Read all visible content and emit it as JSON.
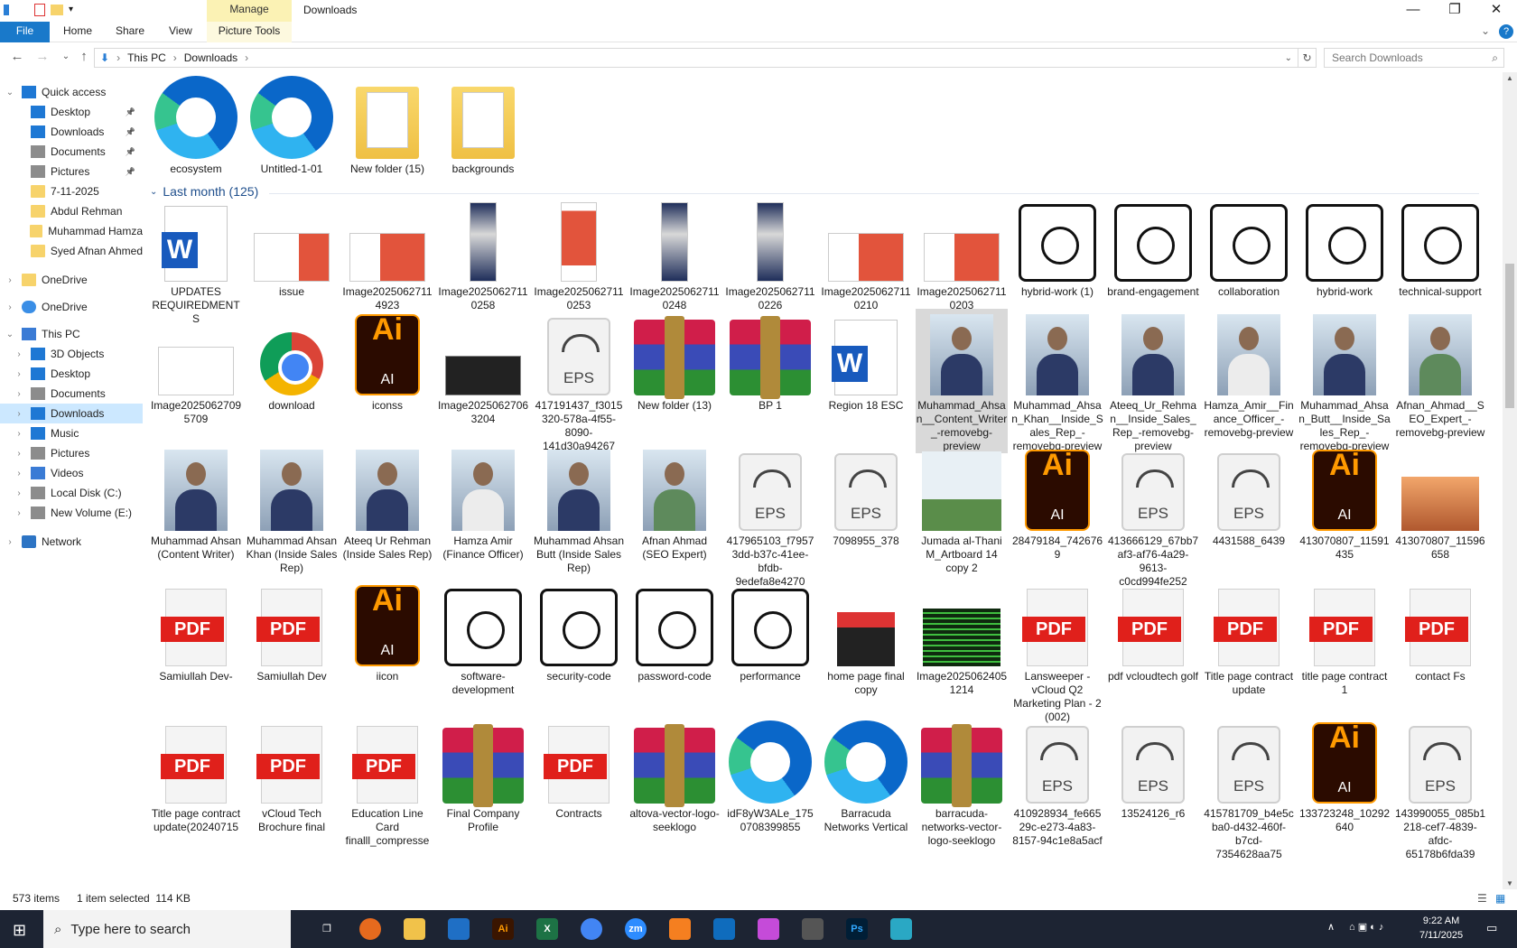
{
  "window": {
    "title": "Downloads",
    "manage_tab": "Manage",
    "controls": {
      "minimize": "—",
      "maximize": "❐",
      "close": "✕"
    }
  },
  "ribbon": {
    "tabs": [
      "File",
      "Home",
      "Share",
      "View"
    ],
    "picture_tools": "Picture Tools"
  },
  "address": {
    "path": [
      "This PC",
      "Downloads"
    ],
    "search_placeholder": "Search Downloads"
  },
  "nav": {
    "items": [
      {
        "label": "Quick access",
        "icon": "star-icon"
      },
      {
        "label": "Desktop",
        "icon": "desktop-icon",
        "pinned": true
      },
      {
        "label": "Downloads",
        "icon": "downloads-icon",
        "pinned": true
      },
      {
        "label": "Documents",
        "icon": "documents-icon",
        "pinned": true
      },
      {
        "label": "Pictures",
        "icon": "pictures-icon",
        "pinned": true
      },
      {
        "label": "7-11-2025",
        "icon": "folder-icon"
      },
      {
        "label": "Abdul Rehman",
        "icon": "folder-icon"
      },
      {
        "label": "Muhammad Hamza",
        "icon": "folder-icon"
      },
      {
        "label": "Syed Afnan Ahmed",
        "icon": "folder-icon"
      },
      {
        "label": "OneDrive",
        "icon": "folder-icon"
      },
      {
        "label": "OneDrive",
        "icon": "cloud-icon"
      },
      {
        "label": "This PC",
        "icon": "pc-icon"
      },
      {
        "label": "3D Objects",
        "icon": "3d-objects-icon"
      },
      {
        "label": "Desktop",
        "icon": "desktop-icon"
      },
      {
        "label": "Documents",
        "icon": "documents-icon"
      },
      {
        "label": "Downloads",
        "icon": "downloads-icon",
        "selected": true
      },
      {
        "label": "Music",
        "icon": "music-icon"
      },
      {
        "label": "Pictures",
        "icon": "pictures-icon"
      },
      {
        "label": "Videos",
        "icon": "videos-icon"
      },
      {
        "label": "Local Disk (C:)",
        "icon": "drive-icon"
      },
      {
        "label": "New Volume (E:)",
        "icon": "drive-icon"
      },
      {
        "label": "Network",
        "icon": "network-icon"
      }
    ]
  },
  "content": {
    "top_items": [
      {
        "label": "ecosystem",
        "kind": "edge"
      },
      {
        "label": "Untitled-1-01",
        "kind": "edge"
      },
      {
        "label": "New folder (15)",
        "kind": "folder"
      },
      {
        "label": "backgrounds",
        "kind": "folder"
      }
    ],
    "group_title": "Last month (125)",
    "rows": [
      [
        {
          "label": "UPDATES REQUIREDMENTS",
          "kind": "word"
        },
        {
          "label": "issue",
          "kind": "screen"
        },
        {
          "label": "Image20250627114923",
          "kind": "docred"
        },
        {
          "label": "Image20250627110258",
          "kind": "tall"
        },
        {
          "label": "Image20250627110253",
          "kind": "tallred"
        },
        {
          "label": "Image20250627110248",
          "kind": "tall"
        },
        {
          "label": "Image20250627110226",
          "kind": "tall"
        },
        {
          "label": "Image20250627110210",
          "kind": "docred"
        },
        {
          "label": "Image20250627110203",
          "kind": "docred"
        },
        {
          "label": "hybrid-work (1)",
          "kind": "line"
        },
        {
          "label": "brand-engagement",
          "kind": "line"
        },
        {
          "label": "collaboration",
          "kind": "line"
        },
        {
          "label": "hybrid-work",
          "kind": "line"
        },
        {
          "label": "technical-support",
          "kind": "line"
        }
      ],
      [
        {
          "label": "Image20250627095709",
          "kind": "docthumb"
        },
        {
          "label": "download",
          "kind": "chrome"
        },
        {
          "label": "iconss",
          "kind": "ai"
        },
        {
          "label": "Image20250627063204",
          "kind": "dark"
        },
        {
          "label": "417191437_f3015320-578a-4f55-8090-141d30a94267",
          "kind": "eps"
        },
        {
          "label": "New folder (13)",
          "kind": "rar"
        },
        {
          "label": "BP 1",
          "kind": "rar"
        },
        {
          "label": "Region 18 ESC",
          "kind": "word"
        },
        {
          "label": "Muhammad_Ahsan__Content_Writer_-removebg-preview",
          "kind": "photo",
          "selected": true
        },
        {
          "label": "Muhammad_Ahsan_Khan__Inside_Sales_Rep_-removebg-preview",
          "kind": "photo"
        },
        {
          "label": "Ateeq_Ur_Rehman__Inside_Sales_Rep_-removebg-preview",
          "kind": "photo"
        },
        {
          "label": "Hamza_Amir__Finance_Officer_-removebg-preview",
          "kind": "photowhite"
        },
        {
          "label": "Muhammad_Ahsan_Butt__Inside_Sales_Rep_-removebg-preview",
          "kind": "photo"
        },
        {
          "label": "Afnan_Ahmad__SEO_Expert_-removebg-preview",
          "kind": "photogreen"
        }
      ],
      [
        {
          "label": "Muhammad Ahsan (Content Writer)",
          "kind": "photo"
        },
        {
          "label": "Muhammad Ahsan Khan (Inside Sales Rep)",
          "kind": "photo"
        },
        {
          "label": "Ateeq Ur Rehman (Inside Sales Rep)",
          "kind": "photo"
        },
        {
          "label": "Hamza Amir (Finance Officer)",
          "kind": "photowhite"
        },
        {
          "label": "Muhammad Ahsan Butt (Inside Sales Rep)",
          "kind": "photo"
        },
        {
          "label": "Afnan Ahmad (SEO Expert)",
          "kind": "photogreen"
        },
        {
          "label": "417965103_f79573dd-b37c-41ee-bfdb-9edefa8e4270",
          "kind": "eps"
        },
        {
          "label": "7098955_378",
          "kind": "eps"
        },
        {
          "label": "Jumada al-Thani M_Artboard 14 copy 2",
          "kind": "arabic"
        },
        {
          "label": "28479184_7426769",
          "kind": "ai"
        },
        {
          "label": "413666129_67bb7af3-af76-4a29-9613-c0cd994fe252",
          "kind": "eps"
        },
        {
          "label": "4431588_6439",
          "kind": "eps"
        },
        {
          "label": "413070807_11591435",
          "kind": "ai"
        },
        {
          "label": "413070807_11596658",
          "kind": "sunset"
        }
      ],
      [
        {
          "label": "Samiullah Dev-",
          "kind": "pdf"
        },
        {
          "label": "Samiullah Dev",
          "kind": "pdf"
        },
        {
          "label": "iicon",
          "kind": "ai"
        },
        {
          "label": "software-development",
          "kind": "line"
        },
        {
          "label": "security-code",
          "kind": "line"
        },
        {
          "label": "password-code",
          "kind": "line"
        },
        {
          "label": "performance",
          "kind": "line"
        },
        {
          "label": "home page final copy",
          "kind": "redcover"
        },
        {
          "label": "Image2025062405 1214",
          "kind": "greenbars"
        },
        {
          "label": "Lansweeper - vCloud Q2 Marketing Plan - 2 (002)",
          "kind": "pdf"
        },
        {
          "label": "pdf vcloudtech golf",
          "kind": "pdf"
        },
        {
          "label": "Title page contract  update",
          "kind": "pdf"
        },
        {
          "label": "title page contract 1",
          "kind": "pdf"
        },
        {
          "label": "contact Fs",
          "kind": "pdf"
        }
      ],
      [
        {
          "label": "Title page contract update(20240715",
          "kind": "pdf"
        },
        {
          "label": "vCloud Tech Brochure final",
          "kind": "pdf"
        },
        {
          "label": "Education Line Card finalll_compresse",
          "kind": "pdf"
        },
        {
          "label": "Final Company Profile",
          "kind": "rar"
        },
        {
          "label": "Contracts",
          "kind": "pdf"
        },
        {
          "label": "altova-vector-logo-seeklogo",
          "kind": "rar"
        },
        {
          "label": "idF8yW3ALe_1750708399855",
          "kind": "edge"
        },
        {
          "label": "Barracuda Networks Vertical",
          "kind": "edge"
        },
        {
          "label": "barracuda-networks-vector-logo-seeklogo",
          "kind": "rar"
        },
        {
          "label": "410928934_fe66529c-e273-4a83-8157-94c1e8a5acf",
          "kind": "eps"
        },
        {
          "label": "13524126_r6",
          "kind": "eps"
        },
        {
          "label": "415781709_b4e5cba0-d432-460f-b7cd-7354628aa75",
          "kind": "eps"
        },
        {
          "label": "133723248_10292640",
          "kind": "ai"
        },
        {
          "label": "143990055_085b1218-cef7-4839-afdc-65178b6fda39",
          "kind": "eps"
        }
      ]
    ]
  },
  "status": {
    "items": "573 items",
    "selection": "1 item selected  114 KB"
  },
  "taskbar": {
    "search_placeholder": "Type here to search",
    "time": "9:22 AM",
    "date": "7/11/2025",
    "apps": [
      "Ai",
      "X",
      "zm",
      "Ps"
    ]
  }
}
